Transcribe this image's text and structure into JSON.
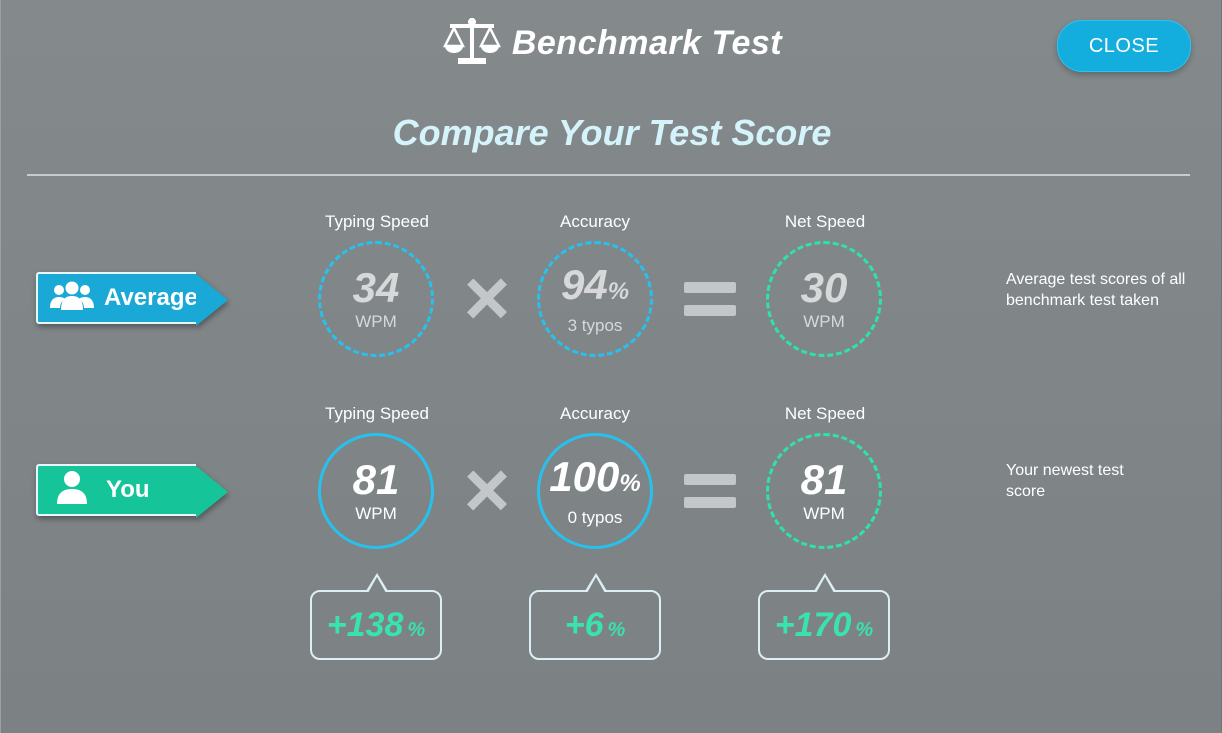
{
  "header": {
    "title": "Benchmark Test",
    "icon": "scale-icon",
    "close_label": "CLOSE"
  },
  "subtitle": "Compare Your Test Score",
  "metrics": {
    "typing_speed": "Typing Speed",
    "accuracy": "Accuracy",
    "net_speed": "Net Speed"
  },
  "average": {
    "label": "Average",
    "icon": "group-icon",
    "typing_speed": "34",
    "typing_unit": "WPM",
    "accuracy": "94",
    "accuracy_unit": "%",
    "typos": "3 typos",
    "net_speed": "30",
    "net_unit": "WPM",
    "note": "Average test scores of all benchmark test taken"
  },
  "you": {
    "label": "You",
    "icon": "user-icon",
    "typing_speed": "81",
    "typing_unit": "WPM",
    "accuracy": "100",
    "accuracy_unit": "%",
    "typos": "0 typos",
    "net_speed": "81",
    "net_unit": "WPM",
    "note": "Your newest test score"
  },
  "diffs": {
    "typing_speed": "+138",
    "accuracy": "+6",
    "net_speed": "+170",
    "unit": "%"
  },
  "operators": {
    "multiply": "×"
  },
  "colors": {
    "background": "#7f8487",
    "accent_blue": "#13aede",
    "accent_green": "#16c49a",
    "diff_green": "#38e3b0",
    "subtitle": "#d4f3fb"
  }
}
